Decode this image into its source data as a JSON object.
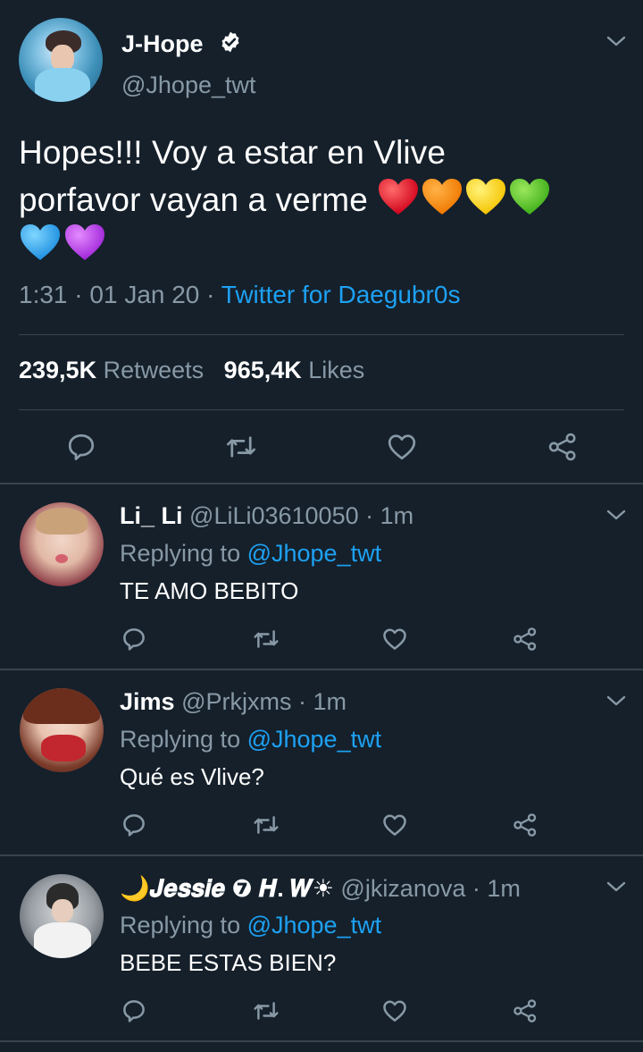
{
  "colors": {
    "background": "#15202b",
    "accent": "#1da1f2",
    "muted": "#8899a6",
    "divider": "#38444d"
  },
  "main_tweet": {
    "name": "J-Hope",
    "handle": "@Jhope_twt",
    "text_line1": "Hopes!!! Voy a estar en Vlive",
    "text_line2": "porfavor vayan a verme",
    "hearts": [
      "red",
      "orange",
      "yellow",
      "green",
      "blue",
      "purple"
    ],
    "time": "1:31",
    "sep1": " · ",
    "date": "01 Jan 20",
    "sep2": " · ",
    "source": "Twitter for Daegubr0s",
    "retweets_count": "239,5K",
    "retweets_label": "Retweets",
    "likes_count": "965,4K",
    "likes_label": "Likes"
  },
  "icons": [
    "reply-icon",
    "retweet-icon",
    "like-icon",
    "share-icon",
    "chevron-down-icon",
    "verified-icon"
  ],
  "replies": [
    {
      "name": "Li_ Li",
      "handle": "@LiLi03610050 · 1m",
      "replying_prefix": "Replying to ",
      "replying_to": "@Jhope_twt",
      "text": "TE AMO BEBITO"
    },
    {
      "name": "Jims",
      "handle": "@Prkjxms · 1m",
      "replying_prefix": "Replying to ",
      "replying_to": "@Jhope_twt",
      "text": "Qué es Vlive?"
    },
    {
      "name": "🌙𝑱𝒆𝒔𝒔𝒊𝒆 ❼ 𝑯. 𝑾☀",
      "handle": "@jkizanova · 1m",
      "replying_prefix": "Replying to ",
      "replying_to": "@Jhope_twt",
      "text": "BEBE ESTAS BIEN?"
    }
  ]
}
